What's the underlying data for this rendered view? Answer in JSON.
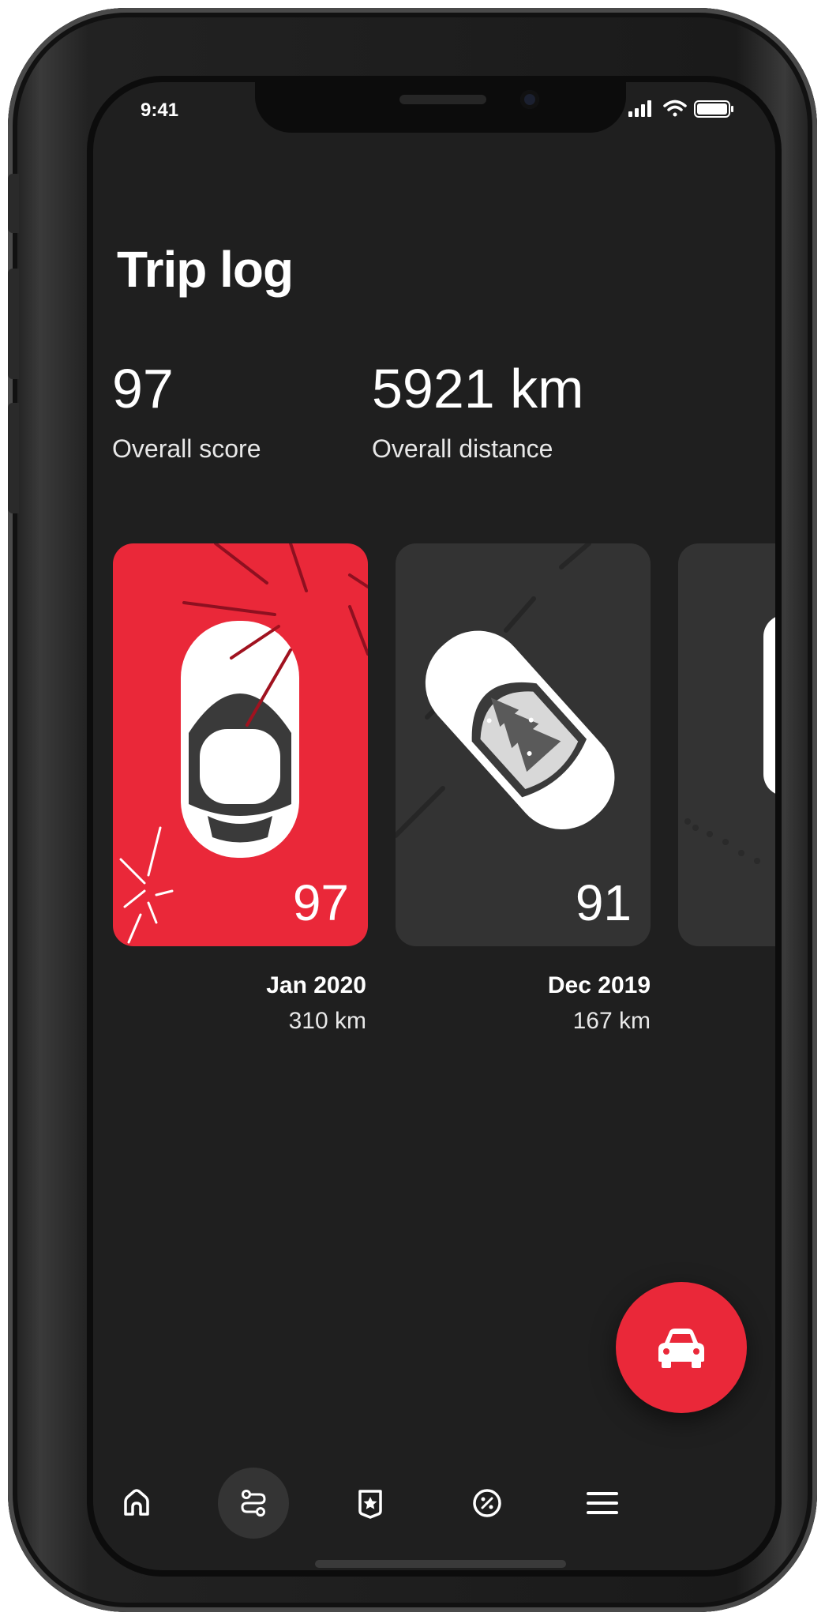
{
  "status_bar": {
    "time": "9:41"
  },
  "header": {
    "title": "Trip log"
  },
  "stats": {
    "score_value": "97",
    "score_label": "Overall score",
    "distance_value": "5921 km",
    "distance_label": "Overall distance"
  },
  "trips": [
    {
      "score": "97",
      "month": "Jan 2020",
      "distance": "310 km",
      "card_color": "#ea2839"
    },
    {
      "score": "91",
      "month": "Dec 2019",
      "distance": "167 km",
      "card_color": "#333333"
    }
  ],
  "fab": {
    "icon": "car-icon",
    "color": "#ea2839"
  },
  "bottom_nav": [
    {
      "icon": "home-icon",
      "active": false
    },
    {
      "icon": "route-icon",
      "active": true
    },
    {
      "icon": "badge-star-icon",
      "active": false
    },
    {
      "icon": "percent-icon",
      "active": false
    },
    {
      "icon": "menu-icon",
      "active": false
    }
  ]
}
